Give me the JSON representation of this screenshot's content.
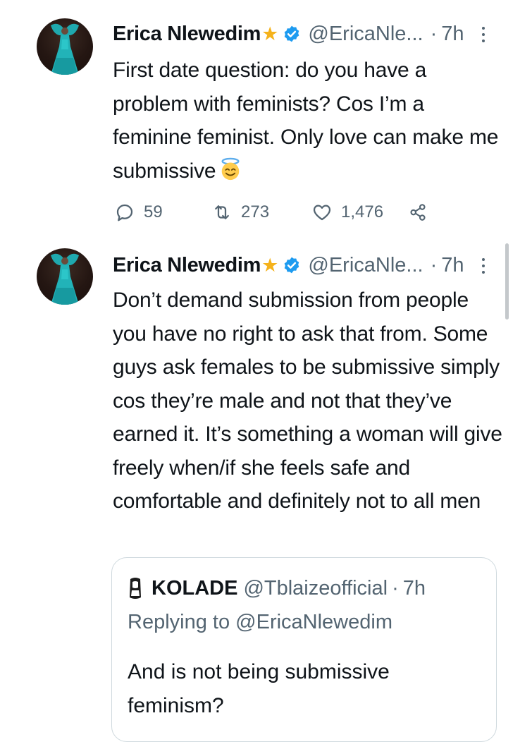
{
  "tweets": [
    {
      "author_name": "Erica Nlewedim",
      "author_badge": "star-icon",
      "verified": true,
      "handle": "@EricaNle...",
      "time": "7h",
      "text": "First date question: do you have a problem with feminists? Cos I’m a feminine feminist. Only love can make me submissive",
      "emoji": "smiling-face-with-halo-icon",
      "replies": "59",
      "retweets": "273",
      "likes": "1,476"
    },
    {
      "author_name": "Erica Nlewedim",
      "author_badge": "star-icon",
      "verified": true,
      "handle": "@EricaNle...",
      "time": "7h",
      "text": "Don’t demand submission from people you have no right to ask that from. Some guys ask females to be submissive simply cos they’re male and not that they’ve earned it. It’s something a woman will give freely when/if she feels safe and comfortable and definitely not to all men",
      "quoted_tweet": {
        "author_name": "KOLADE",
        "handle": "@Tblaizeofficial",
        "time": "7h",
        "replying_to_prefix": "Replying to",
        "replying_to_handle": "@EricaNlewedim",
        "text": "And is not being submissive feminism?"
      }
    }
  ],
  "colors": {
    "text": "#0f1419",
    "secondary": "#536471",
    "verified_blue": "#1d9bf0",
    "star": "#f5b21b",
    "avatar_dress": "#22b3b8"
  }
}
